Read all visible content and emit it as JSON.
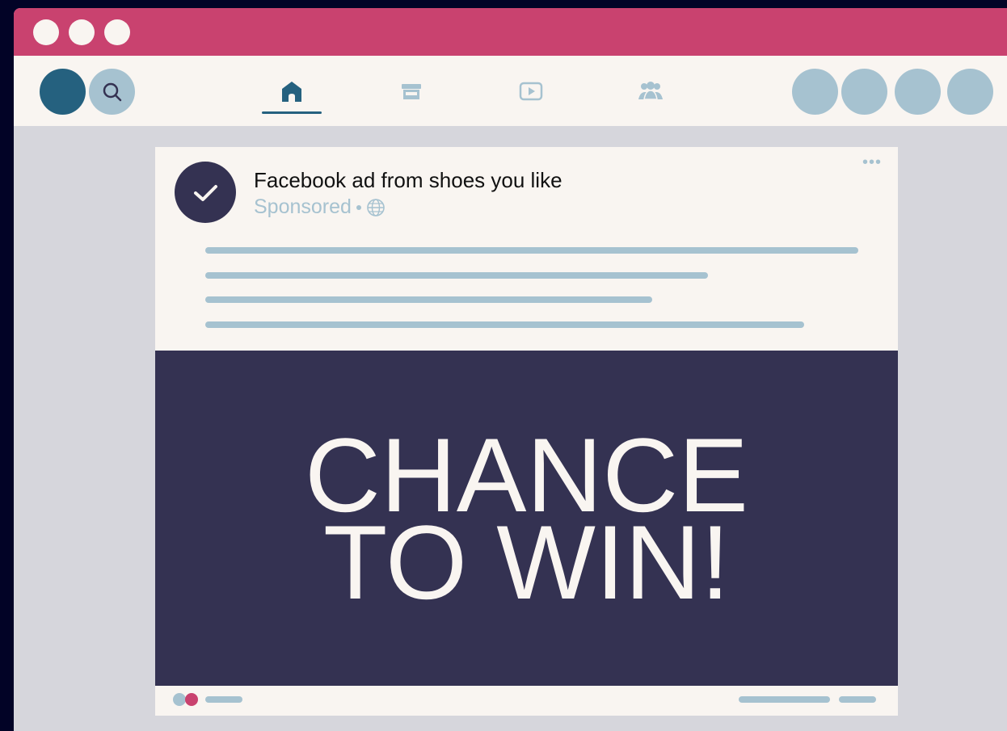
{
  "colors": {
    "background": "#020326",
    "titlebar": "#c9426f",
    "surface": "#f9f5f1",
    "page": "#d6d6dc",
    "accent": "#25617f",
    "muted": "#a6c2d0",
    "banner": "#343252"
  },
  "nav": {
    "tabs": [
      {
        "icon": "home-icon",
        "active": true
      },
      {
        "icon": "store-icon",
        "active": false
      },
      {
        "icon": "video-icon",
        "active": false
      },
      {
        "icon": "groups-icon",
        "active": false
      }
    ]
  },
  "post": {
    "title": "Facebook ad from shoes you like",
    "meta": "Sponsored",
    "more": "•••",
    "audience_icon": "globe-icon",
    "banner_line1": "CHANCE",
    "banner_line2": "TO WIN!"
  }
}
